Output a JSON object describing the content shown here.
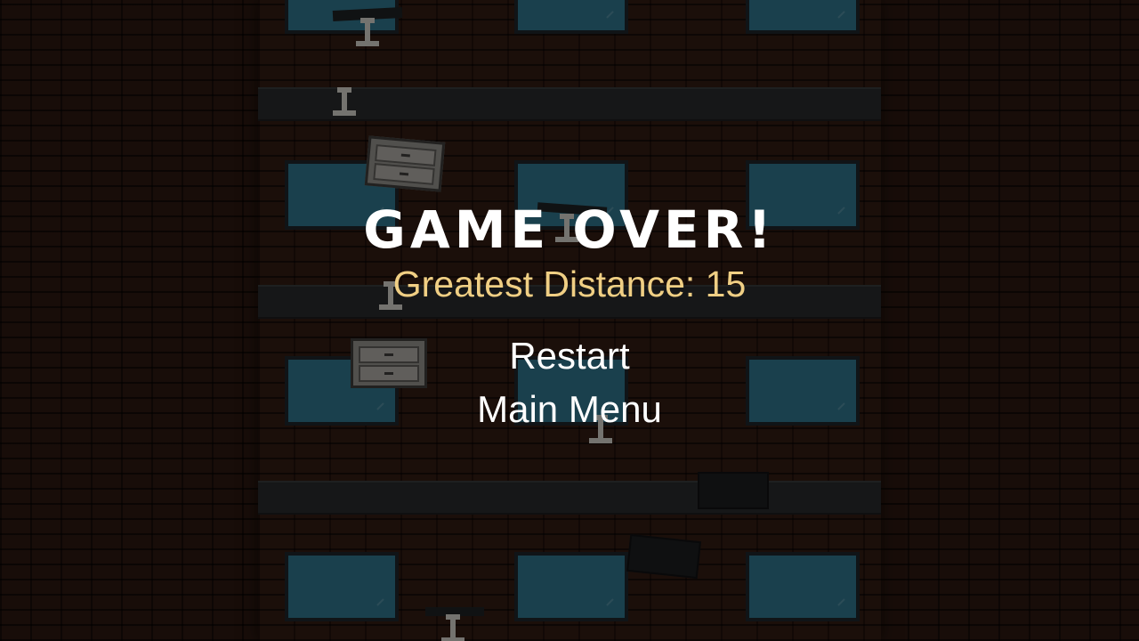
{
  "game_over": {
    "title": "GAME OVER!",
    "distance_label": "Greatest Distance: 15"
  },
  "menu": {
    "restart": "Restart",
    "main_menu": "Main Menu"
  },
  "colors": {
    "distance_text": "#f0cf84",
    "window_glass": "#2d6f85",
    "brick": "#2f1a12"
  }
}
